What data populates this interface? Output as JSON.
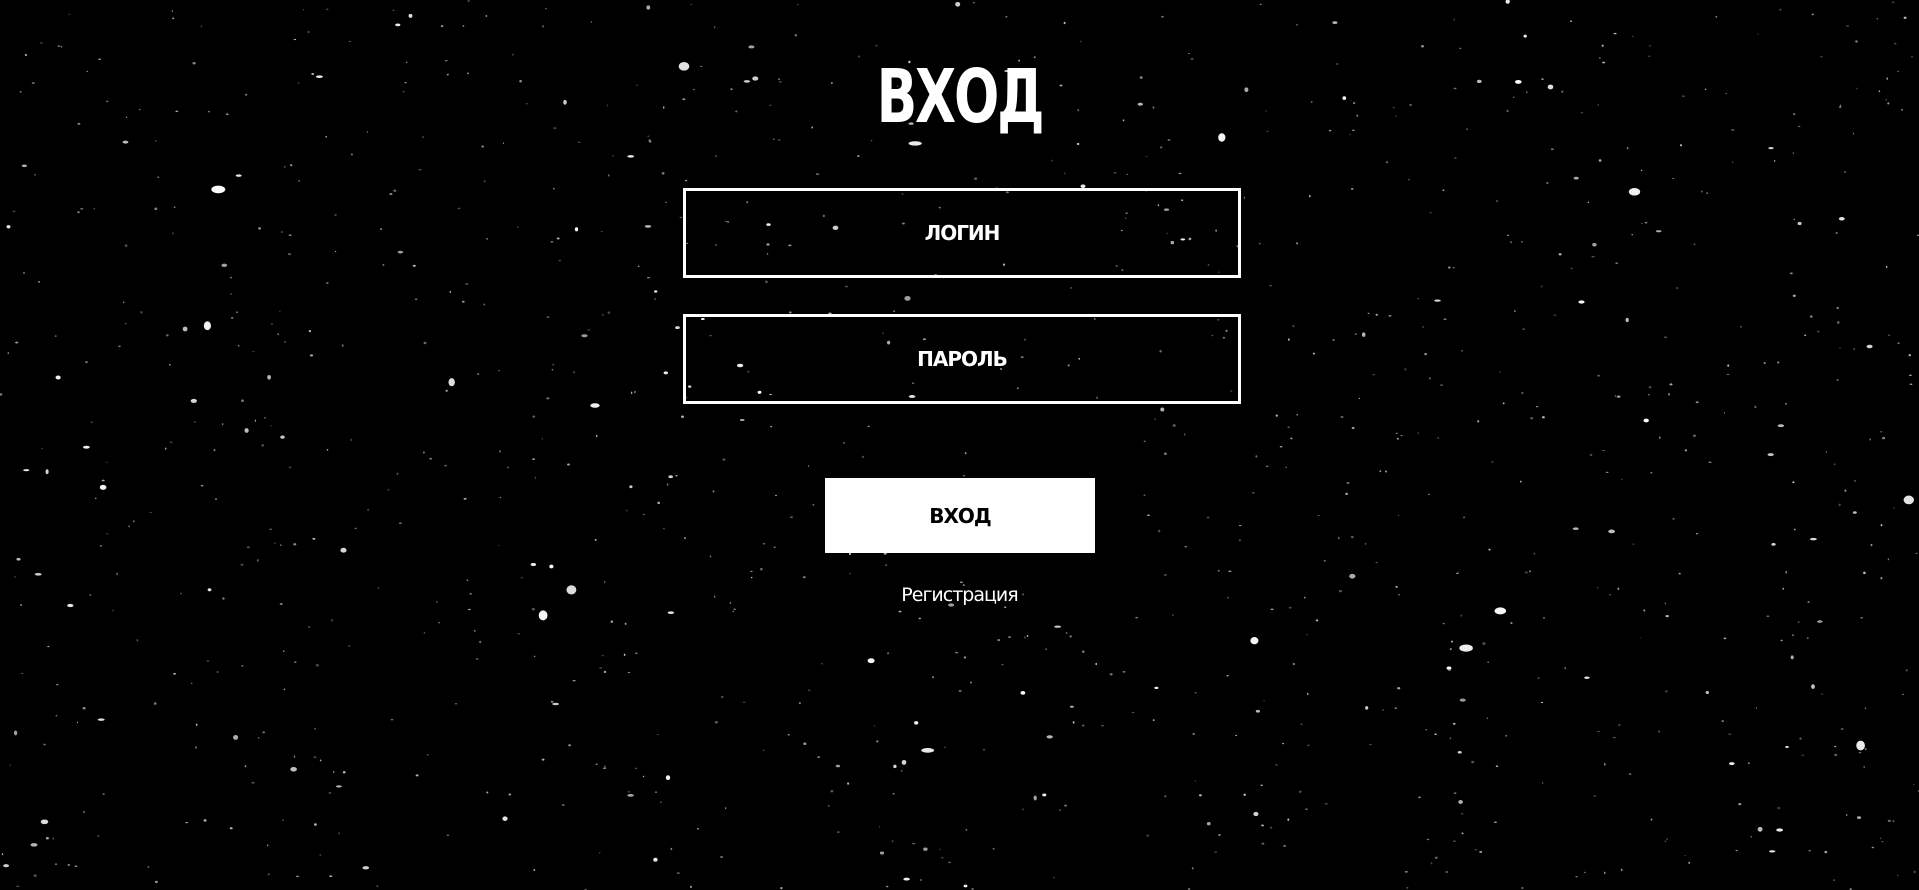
{
  "page": {
    "title": "ВХОД",
    "background_color": "#000000",
    "foreground_color": "#ffffff"
  },
  "form": {
    "login_placeholder": "ЛОГИН",
    "password_placeholder": "ПАРОЛЬ",
    "submit_label": "ВХОД",
    "register_link_label": "Регистрация"
  }
}
